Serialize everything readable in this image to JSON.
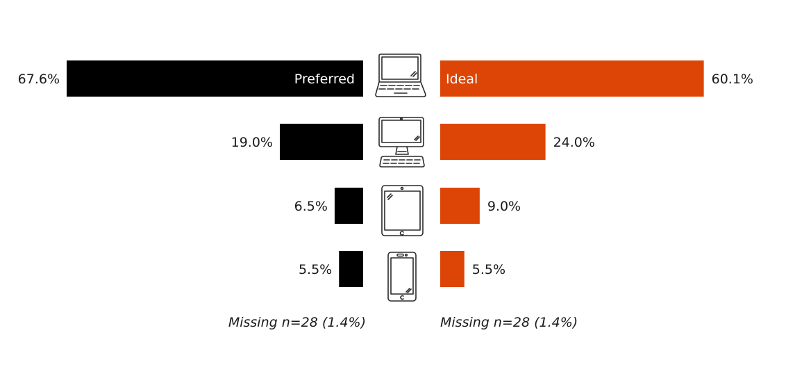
{
  "chart_data": {
    "type": "bar",
    "orientation": "horizontal-diverging",
    "title": "",
    "xlabel": "",
    "ylabel": "",
    "categories": [
      "Laptop",
      "Desktop computer",
      "Tablet",
      "Smartphone"
    ],
    "category_icons": [
      "laptop-icon",
      "desktop-icon",
      "tablet-icon",
      "smartphone-icon"
    ],
    "series": [
      {
        "name": "Preferred",
        "side": "left",
        "color": "#000000",
        "values": [
          67.6,
          19.0,
          6.5,
          5.5
        ],
        "labels": [
          "67.6%",
          "19.0%",
          "6.5%",
          "5.5%"
        ],
        "missing_note": "Missing n=28 (1.4%)"
      },
      {
        "name": "Ideal",
        "side": "right",
        "color": "#DD4506",
        "values": [
          60.1,
          24.0,
          9.0,
          5.5
        ],
        "labels": [
          "60.1%",
          "24.0%",
          "9.0%",
          "5.5%"
        ],
        "missing_note": "Missing n=28 (1.4%)"
      }
    ],
    "value_unit": "%",
    "xlim": [
      0,
      70
    ],
    "grid": false,
    "legend": "inline-in-first-bar"
  }
}
